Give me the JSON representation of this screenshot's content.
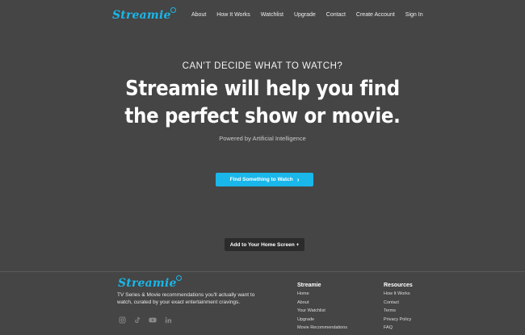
{
  "brand": {
    "name": "Streamie",
    "color": "#1ab7ea"
  },
  "nav": {
    "items": [
      "About",
      "How It Works",
      "Watchlist",
      "Upgrade",
      "Contact",
      "Create Account",
      "Sign In"
    ]
  },
  "hero": {
    "kicker": "CAN'T DECIDE WHAT TO WATCH?",
    "title_line1": "Streamie will help you find",
    "title_line2": "the perfect show or movie.",
    "subtitle": "Powered by Artificial Intelligence",
    "cta_label": "Find Something to Watch",
    "cta_icon": "chevron-right-icon"
  },
  "home_screen": {
    "label": "Add to Your Home Screen +"
  },
  "footer": {
    "brand": "Streamie",
    "description": "TV Series & Movie recommendations you'll actually want to watch, curated by your exact entertainment cravings.",
    "socials": [
      "instagram-icon",
      "tiktok-icon",
      "youtube-icon",
      "linkedin-icon"
    ],
    "col_a": {
      "title": "Streamie",
      "links": [
        "Home",
        "About",
        "Your Watchlist",
        "Upgrade",
        "Movie Recommendations"
      ]
    },
    "col_b": {
      "title": "Resources",
      "links": [
        "How It Works",
        "Contact",
        "Terms",
        "Privacy Policy",
        "FAQ"
      ]
    }
  }
}
